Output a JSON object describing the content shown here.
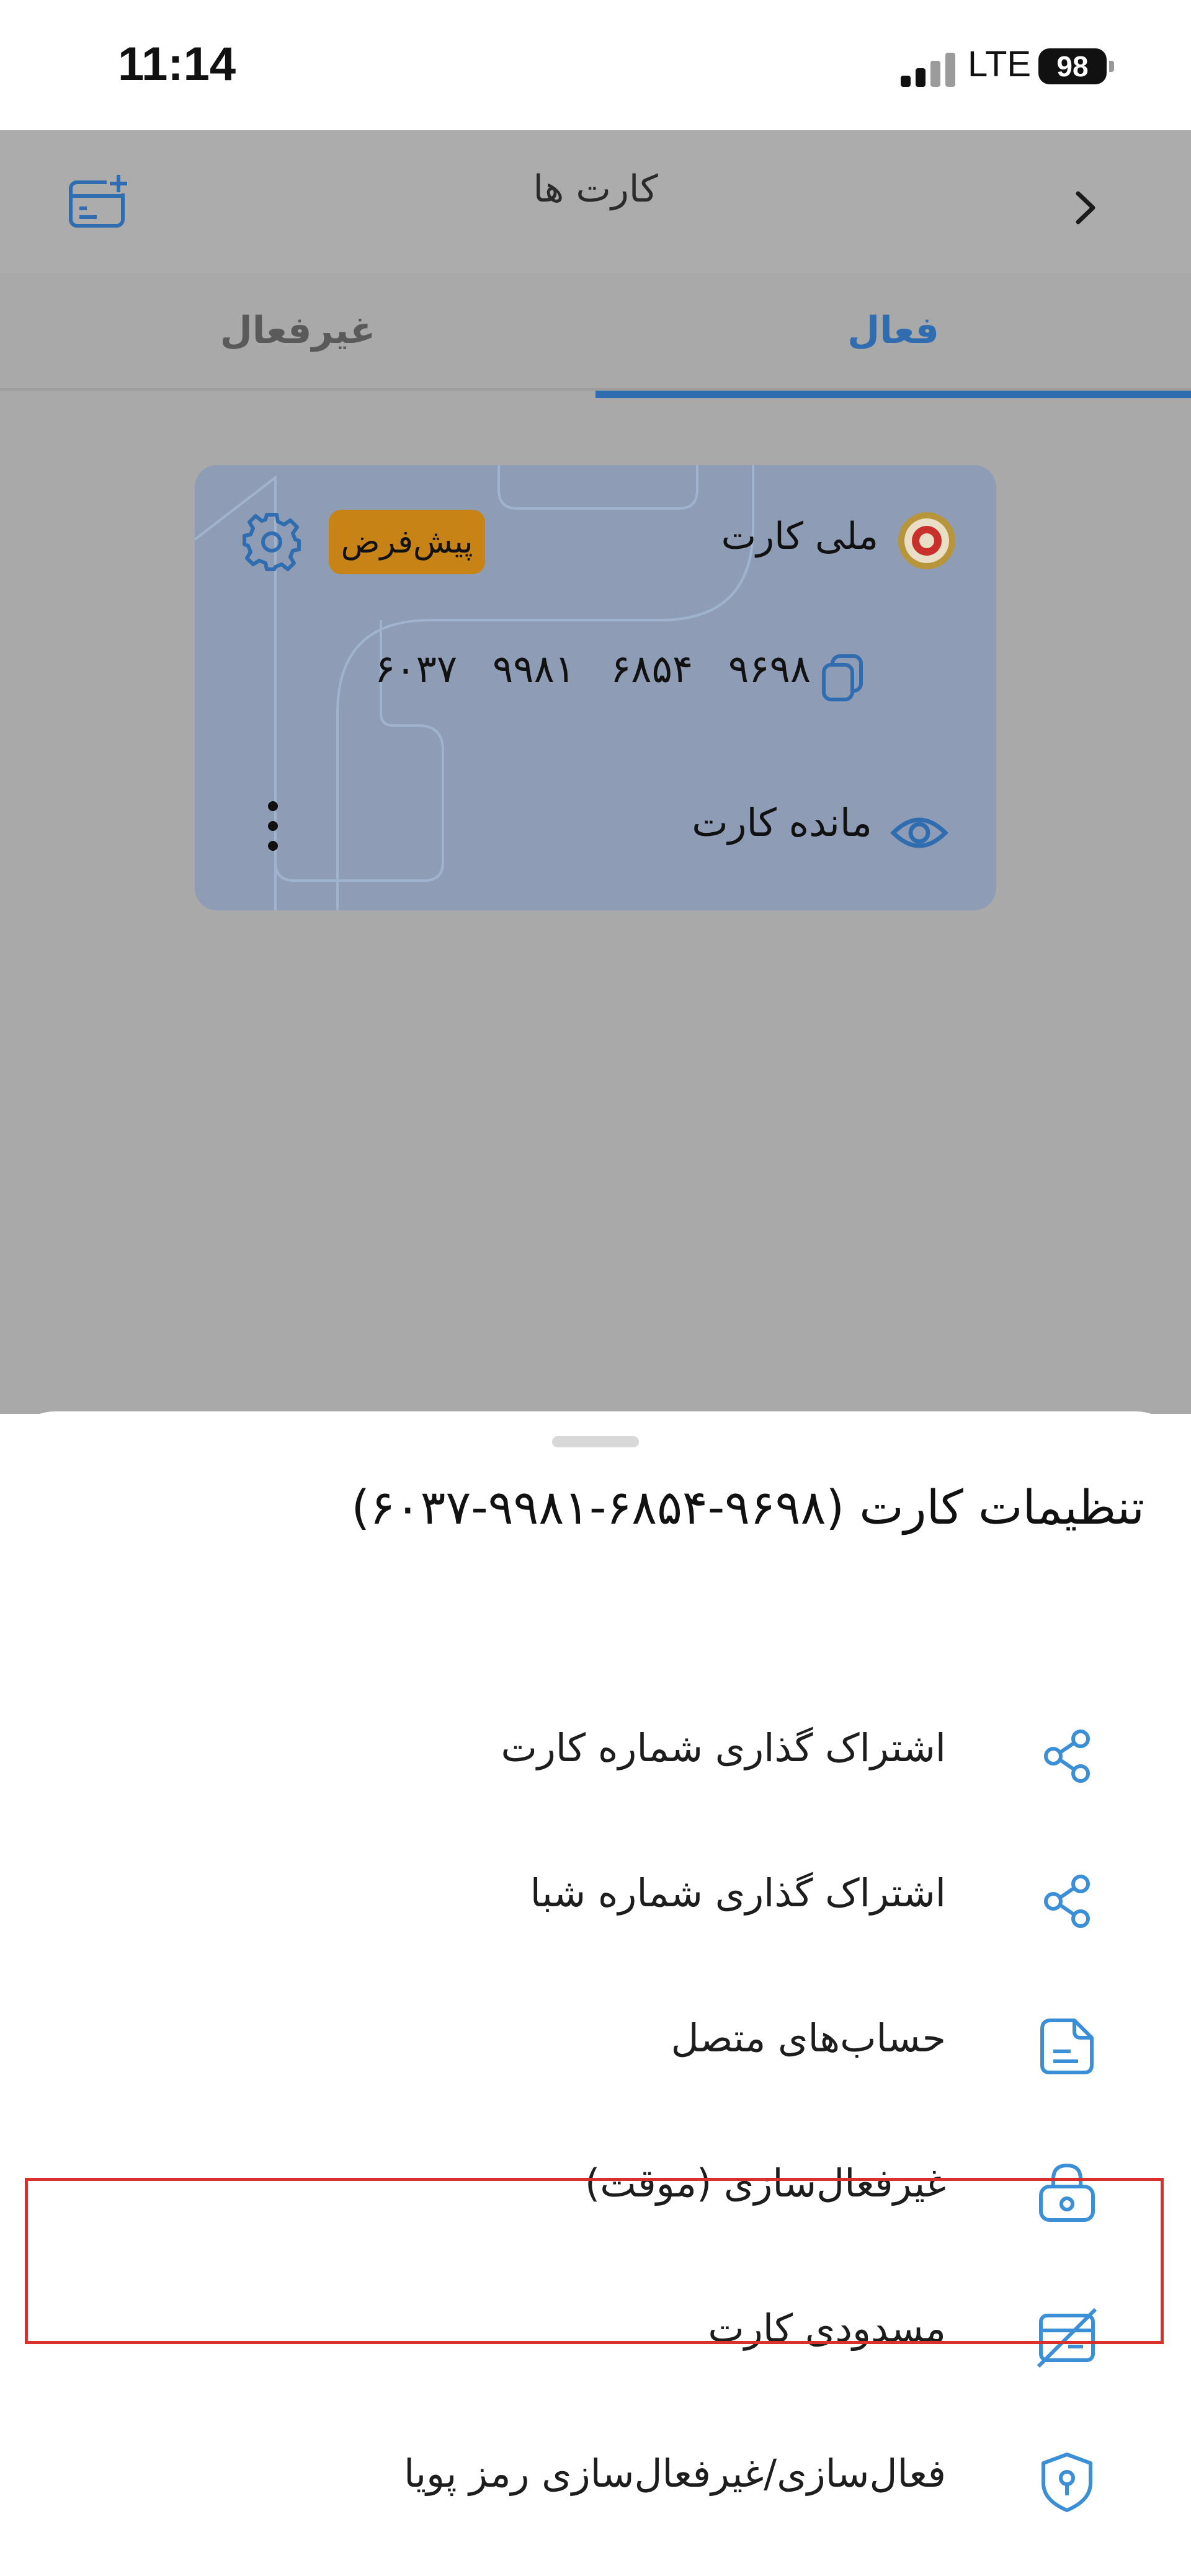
{
  "status_bar": {
    "time": "11:14",
    "network": "LTE",
    "battery": "98"
  },
  "header": {
    "title": "کارت ها"
  },
  "tabs": [
    {
      "label": "فعال",
      "active": true
    },
    {
      "label": "غیرفعال",
      "active": false
    }
  ],
  "card": {
    "bank_name": "ملی کارت",
    "default_badge": "پیش‌فرض",
    "number_groups": [
      "۶۰۳۷",
      "۹۹۸۱",
      "۶۸۵۴",
      "۹۶۹۸"
    ],
    "balance_label": "مانده کارت"
  },
  "sheet": {
    "title": "تنظیمات کارت  (۹۶۹۸-۶۸۵۴-۹۹۸۱-۶۰۳۷)",
    "items": [
      {
        "label": "اشتراک گذاری شماره کارت",
        "icon": "share-icon"
      },
      {
        "label": "اشتراک گذاری شماره شبا",
        "icon": "share-icon"
      },
      {
        "label": "حساب‌های متصل",
        "icon": "document-icon"
      },
      {
        "label": "غیرفعال‌سازی (موقت)",
        "icon": "lock-icon"
      },
      {
        "label": "مسدودی کارت",
        "icon": "card-blocked-icon",
        "highlighted": true
      },
      {
        "label": "فعال‌سازی/غیرفعال‌سازی رمز پویا",
        "icon": "shield-key-icon"
      }
    ]
  },
  "colors": {
    "accent": "#2f6cb0",
    "badge": "#c88316",
    "highlight": "#d9302b",
    "icon_blue": "#3a8fd6"
  }
}
